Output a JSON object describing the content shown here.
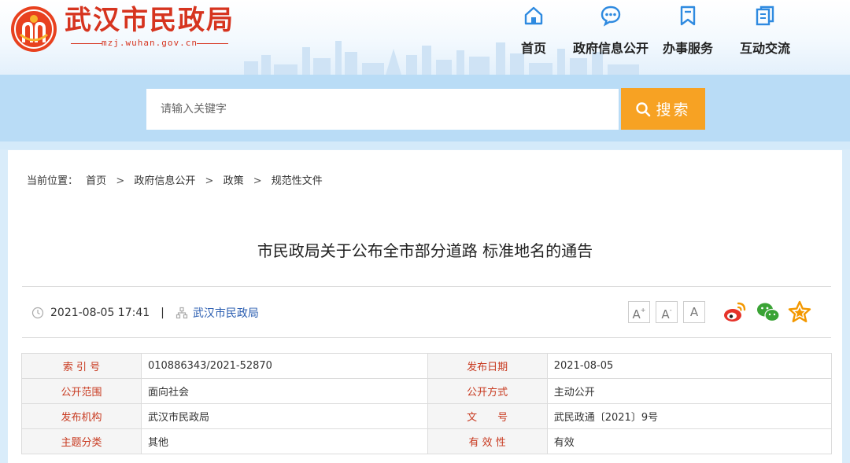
{
  "header": {
    "site_title": "武汉市民政局",
    "site_domain": "mzj.wuhan.gov.cn",
    "nav": [
      {
        "label": "首页",
        "icon": "home-icon"
      },
      {
        "label": "政府信息公开",
        "icon": "chat-bubble-icon"
      },
      {
        "label": "办事服务",
        "icon": "bookmark-icon"
      },
      {
        "label": "互动交流",
        "icon": "documents-icon"
      }
    ]
  },
  "search": {
    "placeholder": "请输入关键字",
    "button_label": "搜索"
  },
  "breadcrumb": {
    "prefix": "当前位置：",
    "items": [
      "首页",
      "政府信息公开",
      "政策",
      "规范性文件"
    ]
  },
  "article": {
    "title": "市民政局关于公布全市部分道路 标准地名的通告",
    "datetime": "2021-08-05 17:41",
    "publisher": "武汉市民政局"
  },
  "font_size_buttons": [
    "A+",
    "A-",
    "A"
  ],
  "share_icons": [
    "weibo-icon",
    "wechat-icon",
    "favorite-star-icon"
  ],
  "info_table": [
    {
      "l1": "索 引 号",
      "v1": "010886343/2021-52870",
      "l2": "发布日期",
      "v2": "2021-08-05"
    },
    {
      "l1": "公开范围",
      "v1": "面向社会",
      "l2": "公开方式",
      "v2": "主动公开"
    },
    {
      "l1": "发布机构",
      "v1": "武汉市民政局",
      "l2": "文　　号",
      "v2": "武民政通〔2021〕9号"
    },
    {
      "l1": "主题分类",
      "v1": "其他",
      "l2": "有 效 性",
      "v2": "有效"
    }
  ],
  "colors": {
    "brand_red": "#d6341f",
    "accent_orange": "#f7a223",
    "nav_blue": "#2e8ae0",
    "band_blue": "#b9dcf6"
  }
}
